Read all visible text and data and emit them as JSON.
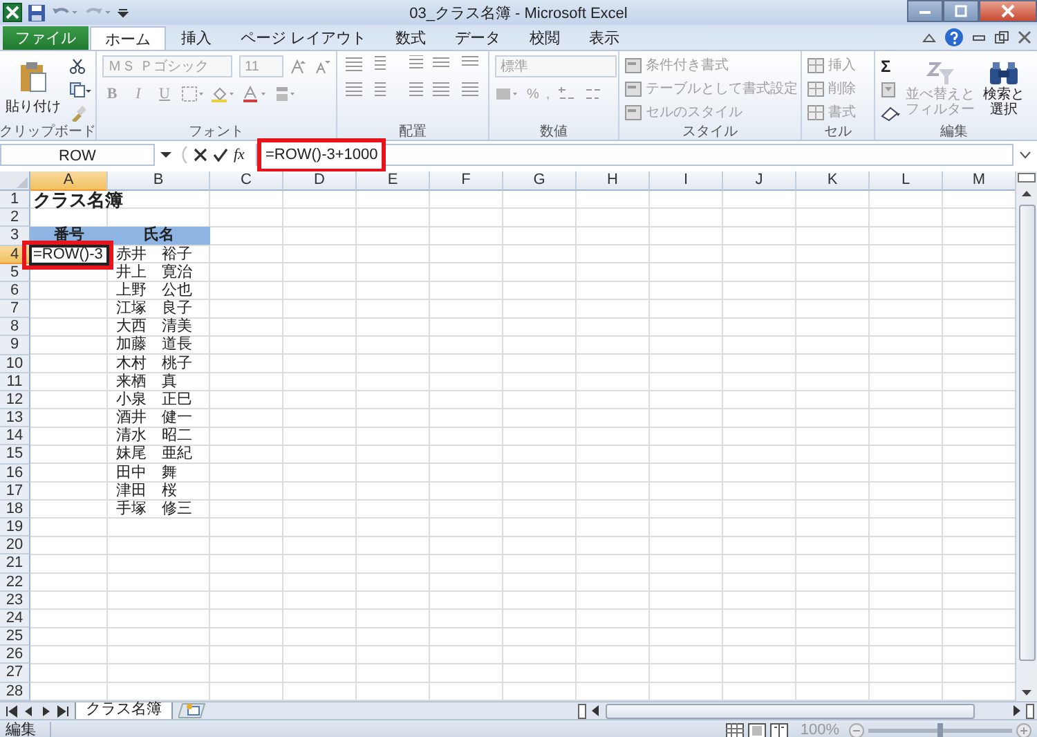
{
  "window": {
    "title": "03_クラス名簿 - Microsoft Excel"
  },
  "ribbon_tabs": [
    {
      "label": "ファイル",
      "kind": "file",
      "selected": false
    },
    {
      "label": "ホーム",
      "kind": "tab",
      "selected": true
    },
    {
      "label": "挿入",
      "kind": "tab",
      "selected": false
    },
    {
      "label": "ページ レイアウト",
      "kind": "tab",
      "selected": false
    },
    {
      "label": "数式",
      "kind": "tab",
      "selected": false
    },
    {
      "label": "データ",
      "kind": "tab",
      "selected": false
    },
    {
      "label": "校閲",
      "kind": "tab",
      "selected": false
    },
    {
      "label": "表示",
      "kind": "tab",
      "selected": false
    }
  ],
  "ribbon": {
    "clipboard": {
      "label": "クリップボード",
      "paste": {
        "label": "貼り付け",
        "disabled": false
      }
    },
    "font": {
      "label": "フォント",
      "font_name": "ＭＳ Ｐゴシック",
      "font_size": "11",
      "style_buttons": [
        "B",
        "I",
        "U"
      ],
      "disabled": true
    },
    "alignment": {
      "label": "配置",
      "disabled": true
    },
    "number": {
      "label": "数値",
      "format": "標準",
      "symbols": [
        "%",
        ","
      ],
      "disabled": true
    },
    "styles": {
      "label": "スタイル",
      "items": [
        {
          "label": "条件付き書式",
          "disabled": true
        },
        {
          "label": "テーブルとして書式設定",
          "disabled": true
        },
        {
          "label": "セルのスタイル",
          "disabled": true
        }
      ]
    },
    "cells": {
      "label": "セル",
      "items": [
        {
          "label": "挿入",
          "disabled": true
        },
        {
          "label": "削除",
          "disabled": true
        },
        {
          "label": "書式",
          "disabled": true
        }
      ]
    },
    "editing": {
      "label": "編集",
      "sum": "Σ",
      "items": [
        {
          "label": "並べ替えとフィルター",
          "kind": "sort",
          "disabled": true
        },
        {
          "label": "検索と選択",
          "kind": "find",
          "disabled": false
        }
      ]
    }
  },
  "formula_bar": {
    "name_box": "ROW",
    "function_label": "fx",
    "formula": "=ROW()-3+1000",
    "highlighted": true
  },
  "columns": [
    {
      "label": "A",
      "selected": true
    },
    {
      "label": "B",
      "selected": false
    },
    {
      "label": "C",
      "selected": false
    },
    {
      "label": "D",
      "selected": false
    },
    {
      "label": "E",
      "selected": false
    },
    {
      "label": "F",
      "selected": false
    },
    {
      "label": "G",
      "selected": false
    },
    {
      "label": "H",
      "selected": false
    },
    {
      "label": "I",
      "selected": false
    },
    {
      "label": "J",
      "selected": false
    },
    {
      "label": "K",
      "selected": false
    },
    {
      "label": "L",
      "selected": false
    },
    {
      "label": "M",
      "selected": false
    }
  ],
  "rows": [
    {
      "header": "1",
      "selected": false,
      "kind": "title",
      "column_a": "クラス名簿"
    },
    {
      "header": "2",
      "selected": false,
      "kind": "empty"
    },
    {
      "header": "3",
      "selected": false,
      "kind": "table_header",
      "column_a": "番号",
      "column_b": "氏名"
    },
    {
      "header": "4",
      "selected": true,
      "kind": "editing",
      "column_a": "=ROW()-3",
      "column_b": "赤井　裕子",
      "highlighted": true
    },
    {
      "header": "5",
      "selected": false,
      "kind": "data",
      "column_b": "井上　寛治"
    },
    {
      "header": "6",
      "selected": false,
      "kind": "data",
      "column_b": "上野　公也"
    },
    {
      "header": "7",
      "selected": false,
      "kind": "data",
      "column_b": "江塚　良子"
    },
    {
      "header": "8",
      "selected": false,
      "kind": "data",
      "column_b": "大西　清美"
    },
    {
      "header": "9",
      "selected": false,
      "kind": "data",
      "column_b": "加藤　道長"
    },
    {
      "header": "10",
      "selected": false,
      "kind": "data",
      "column_b": "木村　桃子"
    },
    {
      "header": "11",
      "selected": false,
      "kind": "data",
      "column_b": "来栖　真"
    },
    {
      "header": "12",
      "selected": false,
      "kind": "data",
      "column_b": "小泉　正巳"
    },
    {
      "header": "13",
      "selected": false,
      "kind": "data",
      "column_b": "酒井　健一"
    },
    {
      "header": "14",
      "selected": false,
      "kind": "data",
      "column_b": "清水　昭二"
    },
    {
      "header": "15",
      "selected": false,
      "kind": "data",
      "column_b": "妹尾　亜紀"
    },
    {
      "header": "16",
      "selected": false,
      "kind": "data",
      "column_b": "田中　舞"
    },
    {
      "header": "17",
      "selected": false,
      "kind": "data",
      "column_b": "津田　桜"
    },
    {
      "header": "18",
      "selected": false,
      "kind": "data",
      "column_b": "手塚　修三"
    },
    {
      "header": "19",
      "selected": false,
      "kind": "empty"
    },
    {
      "header": "20",
      "selected": false,
      "kind": "empty"
    },
    {
      "header": "21",
      "selected": false,
      "kind": "empty"
    },
    {
      "header": "22",
      "selected": false,
      "kind": "empty"
    },
    {
      "header": "23",
      "selected": false,
      "kind": "empty"
    },
    {
      "header": "24",
      "selected": false,
      "kind": "empty"
    },
    {
      "header": "25",
      "selected": false,
      "kind": "empty"
    },
    {
      "header": "26",
      "selected": false,
      "kind": "empty"
    },
    {
      "header": "27",
      "selected": false,
      "kind": "empty"
    },
    {
      "header": "28",
      "selected": false,
      "kind": "empty"
    }
  ],
  "sheet_tabs": [
    {
      "label": "クラス名簿",
      "selected": true
    }
  ],
  "status_bar": {
    "mode": "編集",
    "zoom": "100%",
    "zoom_slider": {
      "level": 0.5
    }
  }
}
